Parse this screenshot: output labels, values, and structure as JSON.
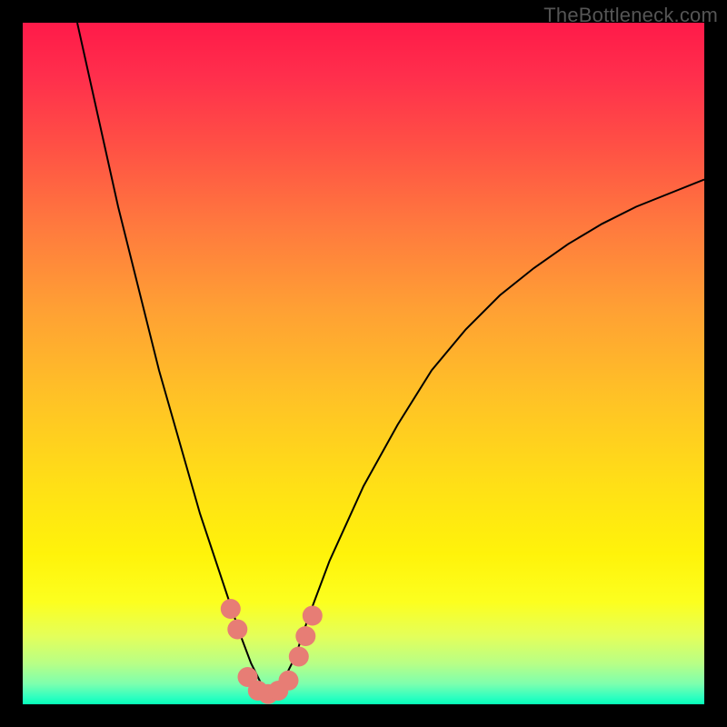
{
  "watermark": "TheBottleneck.com",
  "colors": {
    "frame": "#000000",
    "marker": "#e77d75",
    "curve_stroke": "#000000",
    "gradient_stops": [
      {
        "offset": 0,
        "color": "#ff1a49"
      },
      {
        "offset": 8,
        "color": "#ff2f4c"
      },
      {
        "offset": 18,
        "color": "#ff5045"
      },
      {
        "offset": 30,
        "color": "#ff7a3e"
      },
      {
        "offset": 42,
        "color": "#ffa034"
      },
      {
        "offset": 55,
        "color": "#ffc226"
      },
      {
        "offset": 68,
        "color": "#ffe016"
      },
      {
        "offset": 78,
        "color": "#fff30a"
      },
      {
        "offset": 85,
        "color": "#fcff1f"
      },
      {
        "offset": 90,
        "color": "#e4ff5a"
      },
      {
        "offset": 94,
        "color": "#b8ff86"
      },
      {
        "offset": 97,
        "color": "#7dffae"
      },
      {
        "offset": 99,
        "color": "#2dffc0"
      },
      {
        "offset": 100,
        "color": "#06ffb8"
      }
    ]
  },
  "chart_data": {
    "type": "line",
    "title": "",
    "xlabel": "",
    "ylabel": "",
    "xlim": [
      0,
      100
    ],
    "ylim": [
      0,
      100
    ],
    "description": "V-shaped bottleneck curve over red-to-green vertical gradient. Markers cluster near the bottom of the V. No axis ticks or labels are visible.",
    "series": [
      {
        "name": "bottleneck-curve",
        "x": [
          8,
          10,
          12,
          14,
          16,
          18,
          20,
          22,
          24,
          26,
          28,
          30,
          32,
          33.5,
          35,
          36,
          37,
          38,
          40,
          42,
          45,
          50,
          55,
          60,
          65,
          70,
          75,
          80,
          85,
          90,
          95,
          100
        ],
        "y": [
          100,
          91,
          82,
          73,
          65,
          57,
          49,
          42,
          35,
          28,
          22,
          16,
          10,
          6,
          3,
          1.5,
          1.5,
          3,
          7,
          13,
          21,
          32,
          41,
          49,
          55,
          60,
          64,
          67.5,
          70.5,
          73,
          75,
          77
        ]
      }
    ],
    "markers": [
      {
        "x": 30.5,
        "y": 14
      },
      {
        "x": 31.5,
        "y": 11
      },
      {
        "x": 33.0,
        "y": 4
      },
      {
        "x": 34.5,
        "y": 2
      },
      {
        "x": 36.0,
        "y": 1.5
      },
      {
        "x": 37.5,
        "y": 2
      },
      {
        "x": 39.0,
        "y": 3.5
      },
      {
        "x": 40.5,
        "y": 7
      },
      {
        "x": 41.5,
        "y": 10
      },
      {
        "x": 42.5,
        "y": 13
      }
    ]
  }
}
